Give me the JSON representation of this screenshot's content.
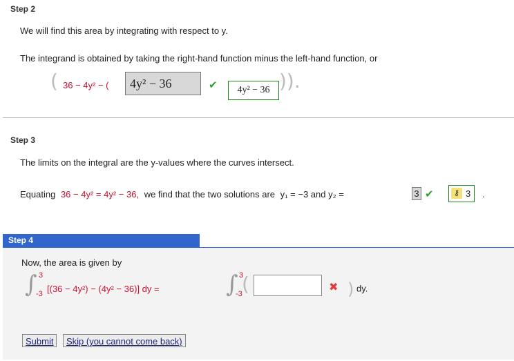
{
  "step2": {
    "title": "Step 2",
    "line1": "We will find this area by integrating with respect to y.",
    "line2": "The integrand is obtained by taking the right-hand function minus the left-hand function, or",
    "expr_left": "36 − 4y² − (",
    "answer_value": "4y² − 36",
    "correct_value": "4y² − 36",
    "closing": ")).",
    "answer_status": "correct"
  },
  "step3": {
    "title": "Step 3",
    "line1": "The limits on the integral are the y-values where the curves intersect.",
    "equating_prefix": "Equating",
    "equation": "36 − 4y² = 4y² − 36,",
    "middle": "we find that the two solutions are",
    "y1_label": "y₁ = −3 and y₂ =",
    "y2_answer": "3",
    "y2_correct": "3",
    "period": ".",
    "answer_status": "correct"
  },
  "step4": {
    "title": "Step 4",
    "line1": "Now, the area is given by",
    "upper_limit": "3",
    "lower_limit": "-3",
    "integrand": "[(36 − 4y²) − (4y² − 36)] dy =",
    "input_value": "",
    "suffix": ") dy.",
    "answer_status": "incorrect",
    "buttons": {
      "submit": "Submit",
      "skip": "Skip (you cannot come back)"
    }
  },
  "colors": {
    "accent": "#3366cc",
    "correct": "#2e9c2e",
    "incorrect": "#e23b3b",
    "math_red": "#c8102e"
  }
}
